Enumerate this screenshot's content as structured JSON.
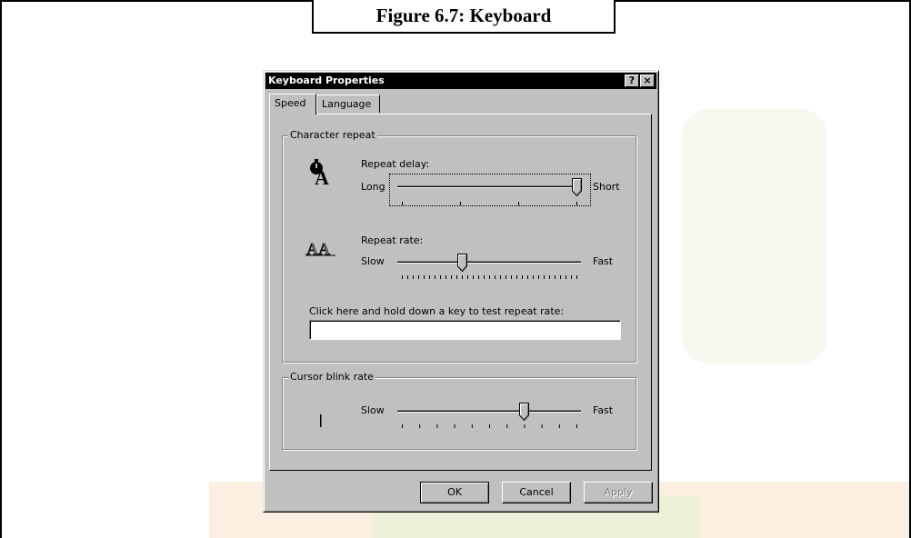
{
  "figure": {
    "caption": "Figure 6.7: Keyboard"
  },
  "dialog": {
    "title": "Keyboard Properties",
    "help_button": "?",
    "close_button": "×",
    "tabs": [
      {
        "label": "Speed",
        "selected": true
      },
      {
        "label": "Language",
        "selected": false
      }
    ],
    "character_repeat": {
      "title": "Character repeat",
      "repeat_delay": {
        "label": "Repeat delay:",
        "min_label": "Long",
        "max_label": "Short",
        "tick_count": 4,
        "position": 3,
        "icon": "stopwatch-a-icon"
      },
      "repeat_rate": {
        "label": "Repeat rate:",
        "min_label": "Slow",
        "max_label": "Fast",
        "tick_count": 33,
        "position": 11,
        "icon": "aa-repeat-icon"
      },
      "test_label": "Click here and hold down a key to test repeat rate:",
      "test_value": ""
    },
    "cursor_blink": {
      "title": "Cursor blink rate",
      "min_label": "Slow",
      "max_label": "Fast",
      "tick_count": 11,
      "position": 7,
      "icon": "text-cursor-icon"
    },
    "buttons": {
      "ok": "OK",
      "cancel": "Cancel",
      "apply": "Apply"
    }
  },
  "colors": {
    "face": "#c0c0c0",
    "titlebar": "#000000",
    "shadow": "#808080",
    "highlight": "#ffffff"
  }
}
